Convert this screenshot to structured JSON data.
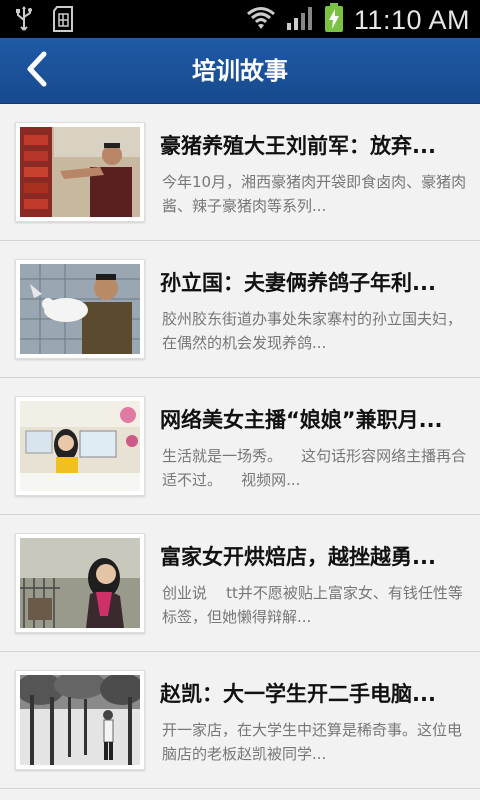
{
  "status_bar": {
    "time": "11:10 AM",
    "icons": [
      "usb-icon",
      "sd-card-icon",
      "wifi-icon",
      "signal-icon",
      "battery-charging-icon"
    ]
  },
  "app_bar": {
    "title": "培训故事",
    "back_icon": "chevron-left-icon"
  },
  "articles": [
    {
      "title": "豪猪养殖大王刘前军：放弃...",
      "desc": "今年10月，湘西豪猪肉开袋即食卤肉、豪猪肉酱、辣子豪猪肉等系列...",
      "thumb": "photo-man-at-shelf"
    },
    {
      "title": "孙立国：夫妻俩养鸽子年利...",
      "desc": "胶州胶东街道办事处朱家寨村的孙立国夫妇，在偶然的机会发现养鸽...",
      "thumb": "photo-man-with-pigeon"
    },
    {
      "title": "网络美女主播“娘娘”兼职月...",
      "desc": "生活就是一场秀。    这句话形容网络主播再合适不过。    视频网...",
      "thumb": "photo-woman-at-computer"
    },
    {
      "title": "富家女开烘焙店，越挫越勇...",
      "desc": "创业说    tt并不愿被贴上富家女、有钱任性等标签，但她懒得辩解...",
      "thumb": "photo-woman-cafe"
    },
    {
      "title": "赵凯：大一学生开二手电脑...",
      "desc": "开一家店，在大学生中还算是稀奇事。这位电脑店的老板赵凯被同学...",
      "thumb": "photo-man-in-trees"
    }
  ],
  "colors": {
    "app_bar": "#1f5aa6",
    "background": "#f2f2f2",
    "title_text": "#111111",
    "desc_text": "#777777"
  }
}
